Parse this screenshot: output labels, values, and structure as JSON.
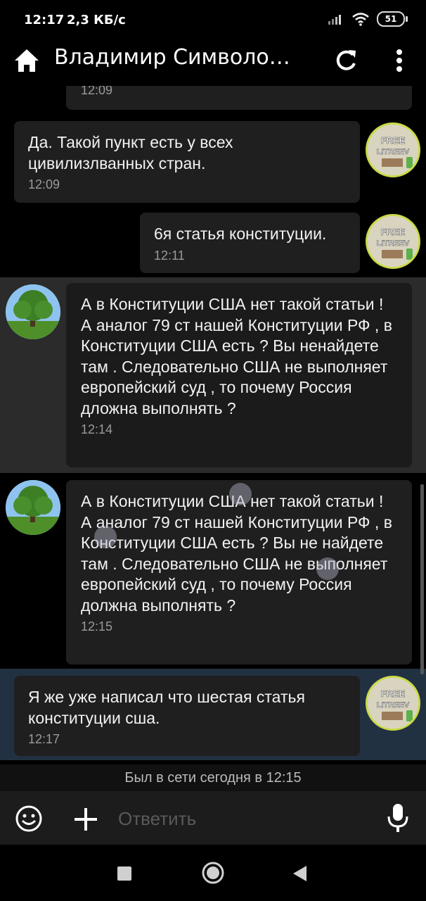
{
  "status_bar": {
    "time": "12:17",
    "speed": "2,3 КБ/с",
    "battery": "51"
  },
  "app_bar": {
    "title": "Владимир Символо…"
  },
  "messages": [
    {
      "time": "12:09"
    },
    {
      "text": "Да. Такой пункт есть у всех цивилизлванных стран.",
      "time": "12:09"
    },
    {
      "text": "6я статья конституции.",
      "time": "12:11"
    },
    {
      "text": "А в Конституции США нет такой статьи ! А аналог 79 ст нашей Конституции РФ , в Конституции США есть ? Вы ненайдете там . Следовательно США не выполняет европейский суд , то почему Россия дложна выполнять ?",
      "time": "12:14"
    },
    {
      "text": "А в Конституции США нет такой статьи ! А аналог 79 ст нашей Конституции РФ , в Конституции США есть ? Вы не найдете там . Следовательно США не выполняет европейский суд , то почему Россия должна выполнять ?",
      "time": "12:15"
    },
    {
      "text": "Я же уже написал что шестая статья конституции сша.",
      "time": "12:17"
    }
  ],
  "avatar_text": {
    "line1": "FREE",
    "line2": "LITREEV"
  },
  "last_seen": "Был в сети сегодня в 12:15",
  "composer": {
    "placeholder": "Ответить"
  },
  "colors": {
    "incoming_row": "#2b2b2b",
    "selected_row": "#213142",
    "bubble": "#1f1f1f"
  }
}
